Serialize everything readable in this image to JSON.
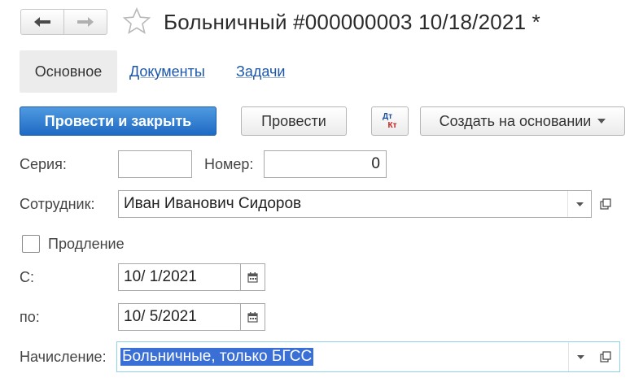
{
  "header": {
    "back_icon": "arrow-left-icon",
    "forward_icon": "arrow-right-icon",
    "favorite_icon": "star-outline-icon",
    "title": "Больничный #000000003 10/18/2021 *"
  },
  "tabs": [
    {
      "label": "Основное",
      "active": true
    },
    {
      "label": "Документы",
      "active": false
    },
    {
      "label": "Задачи",
      "active": false
    }
  ],
  "toolbar": {
    "post_close_label": "Провести и закрыть",
    "post_label": "Провести",
    "dt_label": "Дт",
    "kt_label": "Кт",
    "create_based_label": "Создать на основании",
    "accent_color": "#1f6ac4"
  },
  "form": {
    "series_label": "Серия:",
    "series_value": "",
    "number_label": "Номер:",
    "number_value": "0",
    "employee_label": "Сотрудник:",
    "employee_value": "Иван Иванович Сидоров",
    "extension_label": "Продление",
    "extension_checked": false,
    "from_label": "С:",
    "from_value": "10/ 1/2021",
    "to_label": "по:",
    "to_value": "10/ 5/2021",
    "accrual_label": "Начисление:",
    "accrual_value": "Больничные, только БГСС"
  }
}
